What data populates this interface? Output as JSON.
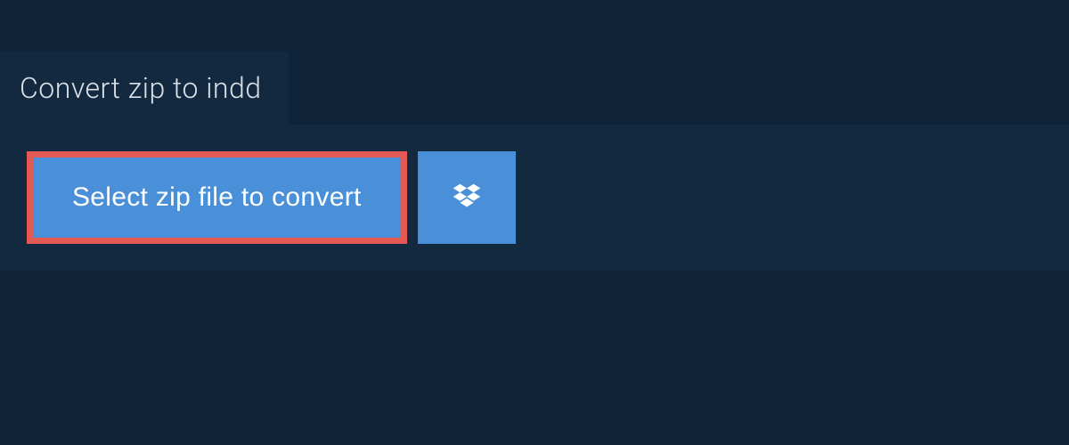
{
  "header": {
    "title": "Convert zip to indd"
  },
  "actions": {
    "select_label": "Select zip file to convert",
    "dropbox_icon": "dropbox"
  },
  "colors": {
    "page_bg": "#0f2438",
    "panel_bg": "#12293f",
    "button_bg": "#4a90d9",
    "highlight_border": "#e35a54",
    "text_light": "#d8e0e6",
    "text_button": "#ffffff"
  }
}
